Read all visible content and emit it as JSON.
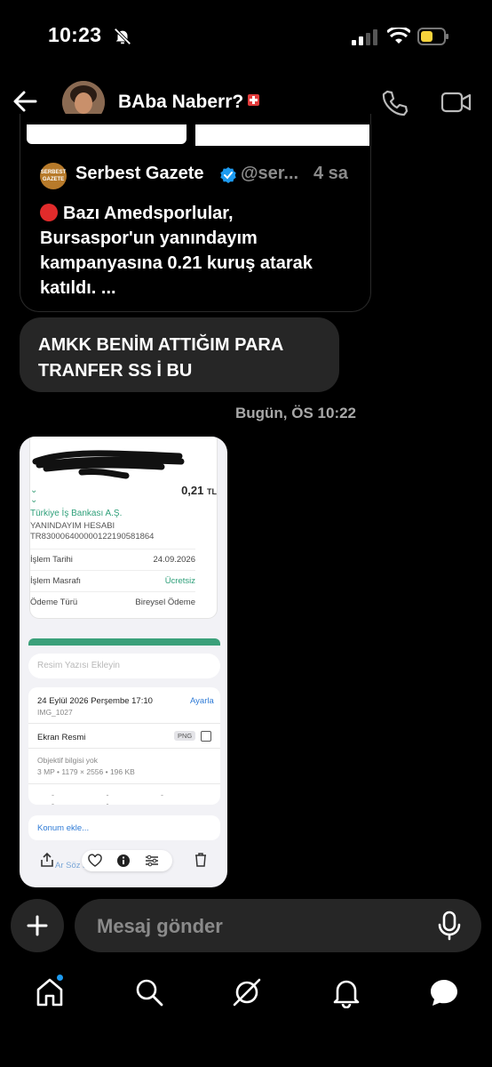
{
  "status_bar": {
    "time": "10:23"
  },
  "header": {
    "chat_name": "BAba Naberr?"
  },
  "shared_post": {
    "author": "Serbest Gazete",
    "logo_text": "SERBEST GAZETE",
    "handle": "@ser...",
    "age": "4 sa",
    "text": "Bazı Amedsporlular, Bursaspor'un yanındayım kampanyasına 0.21 kuruş atarak katıldı. ..."
  },
  "message": {
    "text": "AMKK BENİM ATTIĞIM PARA TRANFER SS İ BU"
  },
  "timestamp": "Bugün, ÖS 10:22",
  "attachment": {
    "amount": "0,21",
    "currency": "TL",
    "bank": "Türkiye İş Bankası A.Ş.",
    "account_name": "YANINDAYIM HESABI",
    "iban": "TR830006400000122190581864",
    "rows": [
      {
        "label": "İşlem Tarihi",
        "value": "24.09.2026"
      },
      {
        "label": "İşlem Masrafı",
        "value": "Ücretsiz"
      },
      {
        "label": "Ödeme Türü",
        "value": "Bireysel Ödeme"
      }
    ],
    "caption_placeholder": "Resim Yazısı Ekleyin",
    "photo_date": "24 Eylül 2026 Perşembe 17:10",
    "adjust": "Ayarla",
    "file_name": "IMG_1027",
    "type": "Ekran Resmi",
    "format": "PNG",
    "lens": "Objektif bilgisi yok",
    "meta": "3 MP • 1179 × 2556 • 196 KB",
    "dashes": "- - - - -",
    "location": "Konum ekle...",
    "ghost_text": "Ar Söz   lip"
  },
  "composer": {
    "placeholder": "Mesaj gönder"
  },
  "colors": {
    "bubble": "#262626",
    "accent_blue": "#1d9bf0",
    "red": "#e12b2b",
    "green": "#3ba07a"
  }
}
